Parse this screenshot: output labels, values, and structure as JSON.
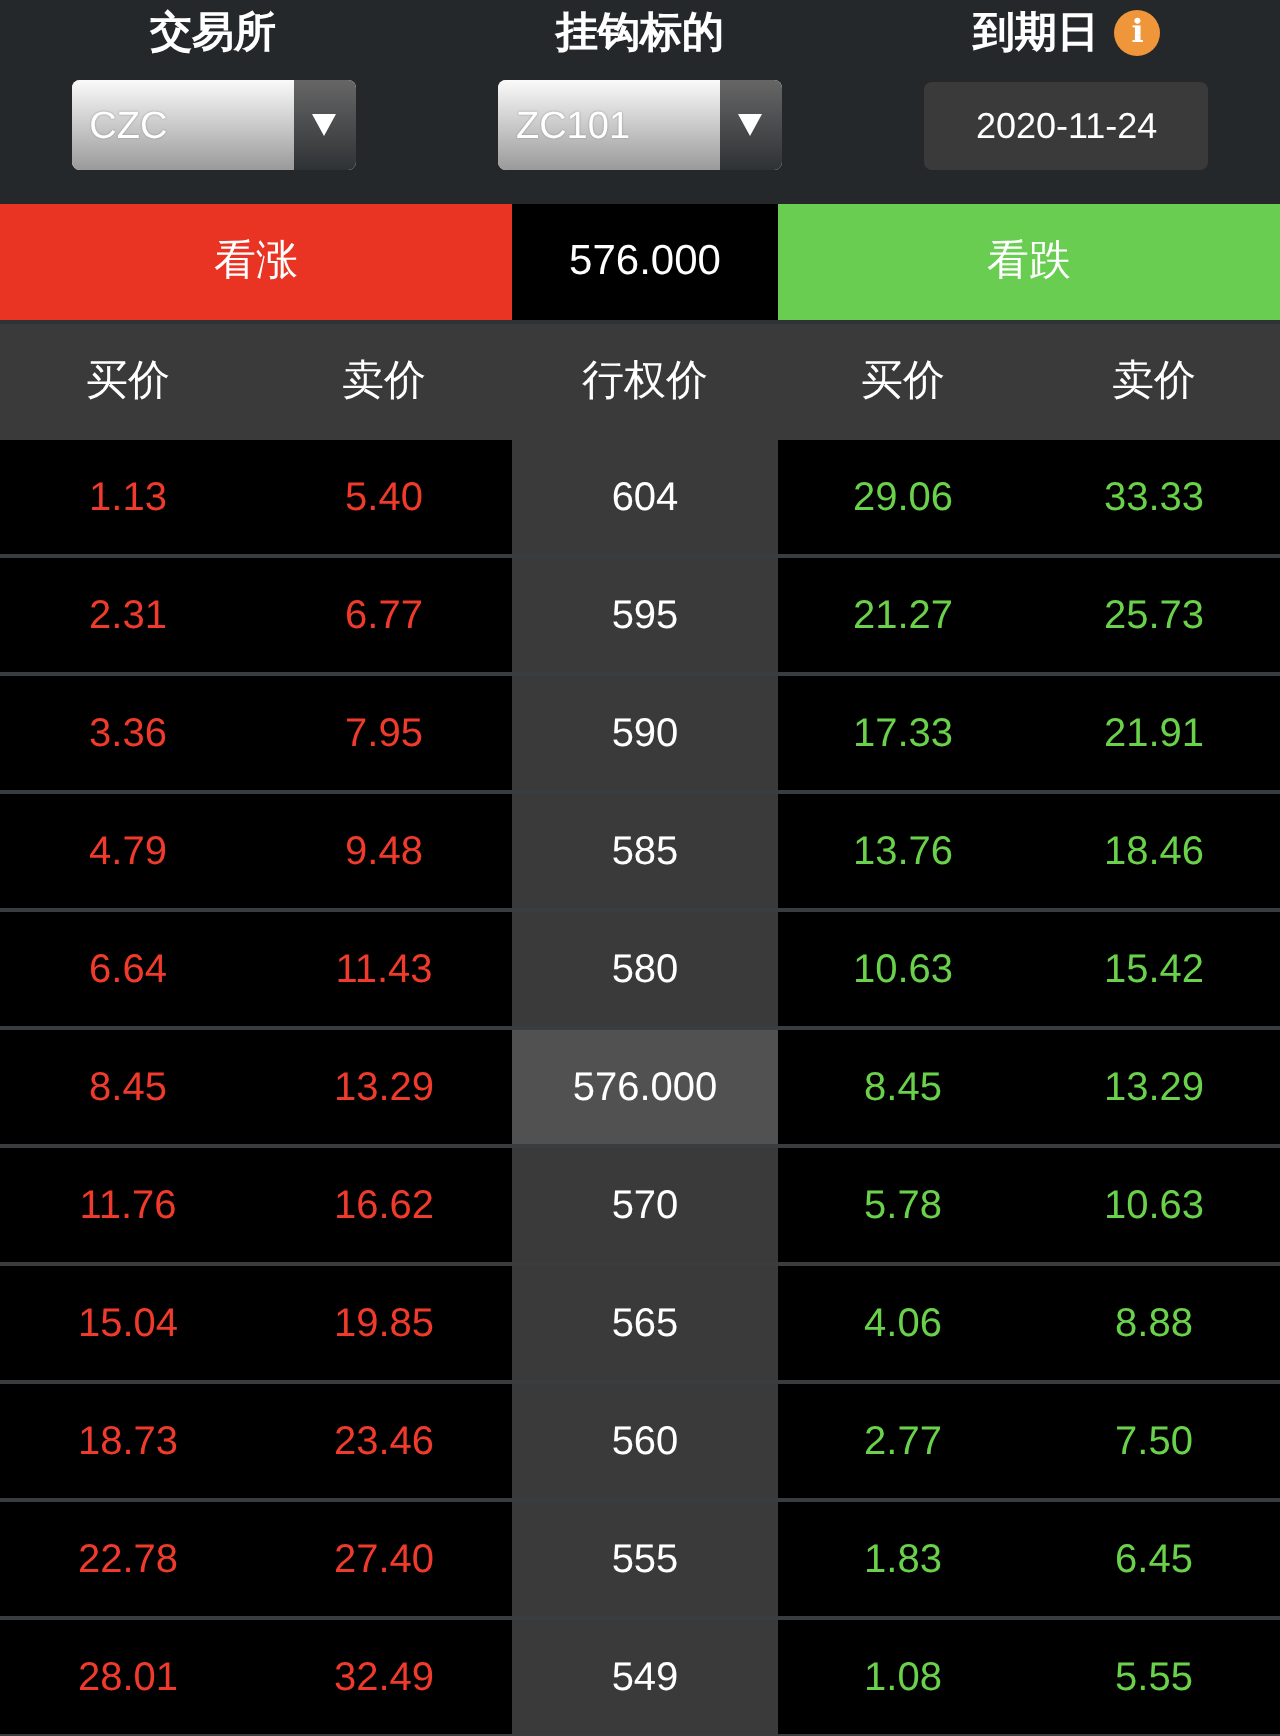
{
  "filters": [
    {
      "kind": "select",
      "label": "交易所",
      "value": "CZC"
    },
    {
      "kind": "select",
      "label": "挂钩标的",
      "value": "ZC101"
    },
    {
      "kind": "date",
      "label": "到期日",
      "value": "2020-11-24",
      "info": "i"
    }
  ],
  "banner": {
    "call": "看涨",
    "price": "576.000",
    "put": "看跌"
  },
  "columns": [
    "买价",
    "卖价",
    "行权价",
    "买价",
    "卖价"
  ],
  "rows": [
    {
      "call_bid": "1.13",
      "call_ask": "5.40",
      "strike": "604",
      "put_bid": "29.06",
      "put_ask": "33.33",
      "current": false
    },
    {
      "call_bid": "2.31",
      "call_ask": "6.77",
      "strike": "595",
      "put_bid": "21.27",
      "put_ask": "25.73",
      "current": false
    },
    {
      "call_bid": "3.36",
      "call_ask": "7.95",
      "strike": "590",
      "put_bid": "17.33",
      "put_ask": "21.91",
      "current": false
    },
    {
      "call_bid": "4.79",
      "call_ask": "9.48",
      "strike": "585",
      "put_bid": "13.76",
      "put_ask": "18.46",
      "current": false
    },
    {
      "call_bid": "6.64",
      "call_ask": "11.43",
      "strike": "580",
      "put_bid": "10.63",
      "put_ask": "15.42",
      "current": false
    },
    {
      "call_bid": "8.45",
      "call_ask": "13.29",
      "strike": "576.000",
      "put_bid": "8.45",
      "put_ask": "13.29",
      "current": true
    },
    {
      "call_bid": "11.76",
      "call_ask": "16.62",
      "strike": "570",
      "put_bid": "5.78",
      "put_ask": "10.63",
      "current": false
    },
    {
      "call_bid": "15.04",
      "call_ask": "19.85",
      "strike": "565",
      "put_bid": "4.06",
      "put_ask": "8.88",
      "current": false
    },
    {
      "call_bid": "18.73",
      "call_ask": "23.46",
      "strike": "560",
      "put_bid": "2.77",
      "put_ask": "7.50",
      "current": false
    },
    {
      "call_bid": "22.78",
      "call_ask": "27.40",
      "strike": "555",
      "put_bid": "1.83",
      "put_ask": "6.45",
      "current": false
    },
    {
      "call_bid": "28.01",
      "call_ask": "32.49",
      "strike": "549",
      "put_bid": "1.08",
      "put_ask": "5.55",
      "current": false
    }
  ]
}
